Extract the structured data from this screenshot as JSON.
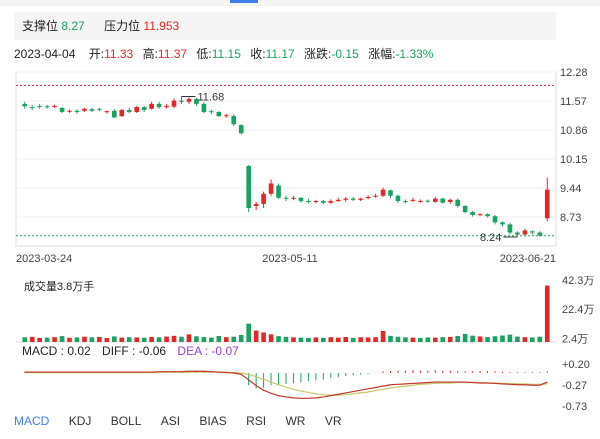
{
  "support": {
    "label": "支撑位",
    "value": "8.27"
  },
  "resistance": {
    "label": "压力位",
    "value": "11.953"
  },
  "info": {
    "date": "2023-04-04",
    "open_label": "开:",
    "open": "11.33",
    "high_label": "高:",
    "high": "11.37",
    "low_label": "低:",
    "low": "11.15",
    "close_label": "收:",
    "close": "11.17",
    "change_label": "涨跌:",
    "change": "-0.15",
    "pct_label": "涨幅:",
    "pct": "-1.33%"
  },
  "volume": {
    "title": "成交量3.8万手"
  },
  "macd": {
    "macd_label": "MACD : ",
    "macd": "0.02",
    "diff_label": "DIFF : ",
    "diff": "-0.06",
    "dea_label": "DEA : ",
    "dea": "-0.07"
  },
  "tabs": [
    "MACD",
    "KDJ",
    "BOLL",
    "ASI",
    "BIAS",
    "RSI",
    "WR",
    "VR"
  ],
  "colors": {
    "up": "#e02828",
    "down": "#1aa260",
    "accent": "#3f7de8",
    "resistance": "#e02828"
  },
  "chart_data": [
    {
      "type": "candlestick",
      "x_labels": [
        "2023-03-24",
        "2023-05-11",
        "2023-06-21"
      ],
      "y_ticks": [
        12.28,
        11.57,
        10.86,
        10.15,
        9.44,
        8.73
      ],
      "ylim": [
        8.02,
        12.28
      ],
      "resistance": 11.953,
      "support": 8.27,
      "annotations": [
        {
          "text": "11.68",
          "value": 11.68
        },
        {
          "text": "8.24",
          "value": 8.24
        }
      ],
      "candles": [
        [
          11.5,
          11.44,
          11.55,
          11.38
        ],
        [
          11.42,
          11.4,
          11.47,
          11.35
        ],
        [
          11.45,
          11.43,
          11.5,
          11.38
        ],
        [
          11.44,
          11.42,
          11.48,
          11.38
        ],
        [
          11.45,
          11.45,
          11.48,
          11.4
        ],
        [
          11.4,
          11.3,
          11.42,
          11.28
        ],
        [
          11.32,
          11.33,
          11.36,
          11.28
        ],
        [
          11.33,
          11.3,
          11.37,
          11.26
        ],
        [
          11.33,
          11.38,
          11.4,
          11.3
        ],
        [
          11.37,
          11.33,
          11.4,
          11.3
        ],
        [
          11.38,
          11.37,
          11.4,
          11.32
        ],
        [
          11.3,
          11.32,
          11.34,
          11.26
        ],
        [
          11.33,
          11.17,
          11.37,
          11.15
        ],
        [
          11.2,
          11.35,
          11.38,
          11.18
        ],
        [
          11.35,
          11.3,
          11.4,
          11.27
        ],
        [
          11.3,
          11.42,
          11.45,
          11.28
        ],
        [
          11.42,
          11.35,
          11.45,
          11.3
        ],
        [
          11.38,
          11.5,
          11.55,
          11.36
        ],
        [
          11.5,
          11.42,
          11.55,
          11.38
        ],
        [
          11.42,
          11.45,
          11.5,
          11.38
        ],
        [
          11.43,
          11.58,
          11.63,
          11.4
        ],
        [
          11.58,
          11.55,
          11.68,
          11.5
        ],
        [
          11.55,
          11.62,
          11.66,
          11.5
        ],
        [
          11.62,
          11.5,
          11.65,
          11.45
        ],
        [
          11.5,
          11.3,
          11.55,
          11.27
        ],
        [
          11.32,
          11.3,
          11.36,
          11.25
        ],
        [
          11.3,
          11.2,
          11.32,
          11.18
        ],
        [
          11.22,
          11.22,
          11.26,
          11.16
        ],
        [
          11.2,
          11.0,
          11.24,
          10.96
        ],
        [
          10.98,
          10.78,
          11.0,
          10.75
        ],
        [
          9.98,
          8.95,
          10.0,
          8.85
        ],
        [
          9.0,
          9.05,
          9.1,
          8.9
        ],
        [
          9.05,
          9.3,
          9.35,
          8.95
        ],
        [
          9.3,
          9.55,
          9.65,
          9.25
        ],
        [
          9.5,
          9.2,
          9.55,
          9.18
        ],
        [
          9.2,
          9.18,
          9.25,
          9.12
        ],
        [
          9.18,
          9.2,
          9.25,
          9.14
        ],
        [
          9.2,
          9.12,
          9.22,
          9.08
        ],
        [
          9.12,
          9.1,
          9.18,
          9.06
        ],
        [
          9.1,
          9.12,
          9.15,
          9.06
        ],
        [
          9.12,
          9.08,
          9.15,
          9.04
        ],
        [
          9.08,
          9.12,
          9.16,
          9.05
        ],
        [
          9.12,
          9.15,
          9.2,
          9.1
        ],
        [
          9.15,
          9.18,
          9.22,
          9.1
        ],
        [
          9.18,
          9.15,
          9.22,
          9.12
        ],
        [
          9.15,
          9.18,
          9.2,
          9.12
        ],
        [
          9.2,
          9.22,
          9.26,
          9.16
        ],
        [
          9.25,
          9.25,
          9.3,
          9.2
        ],
        [
          9.25,
          9.4,
          9.45,
          9.22
        ],
        [
          9.38,
          9.25,
          9.4,
          9.2
        ],
        [
          9.25,
          9.12,
          9.28,
          9.08
        ],
        [
          9.12,
          9.1,
          9.16,
          9.06
        ],
        [
          9.15,
          9.15,
          9.2,
          9.1
        ],
        [
          9.12,
          9.12,
          9.16,
          9.08
        ],
        [
          9.13,
          9.12,
          9.16,
          9.08
        ],
        [
          9.1,
          9.18,
          9.22,
          9.08
        ],
        [
          9.18,
          9.08,
          9.2,
          9.06
        ],
        [
          9.1,
          9.15,
          9.18,
          9.05
        ],
        [
          9.15,
          9.0,
          9.18,
          8.96
        ],
        [
          9.0,
          8.85,
          9.02,
          8.82
        ],
        [
          8.85,
          8.78,
          8.88,
          8.74
        ],
        [
          8.78,
          8.8,
          8.82,
          8.75
        ],
        [
          8.8,
          8.75,
          8.82,
          8.72
        ],
        [
          8.75,
          8.6,
          8.78,
          8.55
        ],
        [
          8.6,
          8.55,
          8.62,
          8.5
        ],
        [
          8.55,
          8.35,
          8.58,
          8.3
        ],
        [
          8.35,
          8.3,
          8.38,
          8.24
        ],
        [
          8.3,
          8.4,
          8.44,
          8.28
        ],
        [
          8.38,
          8.35,
          8.4,
          8.3
        ],
        [
          8.35,
          8.28,
          8.38,
          8.25
        ],
        [
          8.7,
          9.4,
          9.7,
          8.62
        ]
      ]
    },
    {
      "type": "bar",
      "name": "volume",
      "unit": "万手",
      "y_ticks": [
        "42.3万",
        "22.4万",
        "2.4万"
      ],
      "ylim": [
        0,
        42.3
      ],
      "values": [
        3.2,
        3.5,
        2.8,
        3.0,
        3.3,
        4.0,
        2.9,
        3.1,
        3.6,
        3.2,
        3.4,
        2.7,
        3.8,
        3.0,
        3.3,
        3.1,
        2.9,
        3.5,
        3.2,
        3.7,
        4.2,
        3.6,
        5.2,
        3.9,
        3.4,
        3.0,
        4.1,
        3.3,
        3.6,
        4.8,
        12.5,
        7.8,
        6.5,
        5.2,
        4.0,
        3.5,
        3.2,
        3.0,
        2.8,
        3.1,
        2.9,
        3.3,
        3.0,
        3.4,
        2.8,
        3.2,
        3.1,
        3.3,
        7.5,
        4.2,
        3.6,
        3.2,
        3.0,
        2.8,
        3.1,
        3.0,
        3.3,
        3.5,
        4.1,
        5.5,
        4.3,
        3.8,
        3.4,
        3.9,
        4.4,
        5.0,
        3.7,
        3.3,
        3.1,
        3.6,
        38.5
      ],
      "up": [
        0,
        1,
        1,
        0,
        1,
        0,
        1,
        0,
        1,
        0,
        1,
        1,
        0,
        1,
        0,
        1,
        0,
        1,
        0,
        1,
        1,
        0,
        1,
        0,
        0,
        0,
        0,
        1,
        0,
        0,
        0,
        1,
        1,
        1,
        0,
        0,
        1,
        0,
        0,
        1,
        0,
        1,
        1,
        1,
        0,
        1,
        1,
        1,
        1,
        0,
        0,
        0,
        1,
        0,
        0,
        1,
        0,
        1,
        0,
        0,
        0,
        1,
        0,
        0,
        0,
        0,
        0,
        1,
        0,
        0,
        1
      ]
    },
    {
      "type": "line",
      "name": "MACD",
      "y_ticks": [
        "+0.20",
        "-0.27",
        "-0.73"
      ],
      "ylim": [
        -0.73,
        0.2
      ],
      "hist": [
        0.03,
        0.03,
        0.03,
        0.02,
        0.02,
        0.02,
        0.02,
        0.02,
        0.02,
        0.03,
        0.03,
        0.03,
        0.02,
        0.03,
        0.03,
        0.03,
        0.03,
        0.03,
        0.03,
        0.03,
        0.04,
        0.04,
        0.05,
        0.04,
        0.03,
        0.02,
        0.01,
        0.0,
        -0.02,
        -0.04,
        -0.3,
        -0.38,
        -0.36,
        -0.3,
        -0.3,
        -0.27,
        -0.25,
        -0.23,
        -0.2,
        -0.18,
        -0.16,
        -0.12,
        -0.1,
        -0.07,
        -0.06,
        -0.04,
        -0.02,
        0.0,
        0.04,
        0.05,
        0.06,
        0.06,
        0.07,
        0.06,
        0.06,
        0.07,
        0.06,
        0.06,
        0.05,
        0.04,
        0.04,
        0.05,
        0.05,
        0.04,
        0.03,
        0.02,
        0.02,
        0.02,
        0.02,
        0.02,
        0.04
      ],
      "diff": [
        0.02,
        0.02,
        0.02,
        0.02,
        0.02,
        0.02,
        0.02,
        0.02,
        0.02,
        0.02,
        0.02,
        0.02,
        0.02,
        0.02,
        0.02,
        0.02,
        0.02,
        0.02,
        0.03,
        0.03,
        0.03,
        0.03,
        0.04,
        0.04,
        0.04,
        0.03,
        0.02,
        0.01,
        0.0,
        -0.03,
        -0.15,
        -0.28,
        -0.38,
        -0.45,
        -0.5,
        -0.53,
        -0.55,
        -0.56,
        -0.56,
        -0.55,
        -0.53,
        -0.5,
        -0.47,
        -0.44,
        -0.41,
        -0.38,
        -0.35,
        -0.32,
        -0.29,
        -0.26,
        -0.25,
        -0.24,
        -0.23,
        -0.22,
        -0.21,
        -0.2,
        -0.2,
        -0.2,
        -0.2,
        -0.2,
        -0.21,
        -0.22,
        -0.22,
        -0.23,
        -0.24,
        -0.25,
        -0.26,
        -0.26,
        -0.27,
        -0.27,
        -0.2
      ],
      "dea": [
        0.01,
        0.01,
        0.01,
        0.01,
        0.01,
        0.01,
        0.01,
        0.01,
        0.01,
        0.01,
        0.01,
        0.01,
        0.01,
        0.01,
        0.01,
        0.01,
        0.01,
        0.01,
        0.01,
        0.02,
        0.02,
        0.02,
        0.02,
        0.02,
        0.02,
        0.02,
        0.02,
        0.02,
        0.01,
        0.0,
        -0.03,
        -0.08,
        -0.14,
        -0.2,
        -0.26,
        -0.31,
        -0.36,
        -0.4,
        -0.43,
        -0.46,
        -0.48,
        -0.49,
        -0.49,
        -0.48,
        -0.46,
        -0.44,
        -0.42,
        -0.39,
        -0.36,
        -0.33,
        -0.31,
        -0.29,
        -0.27,
        -0.25,
        -0.24,
        -0.23,
        -0.22,
        -0.22,
        -0.21,
        -0.21,
        -0.21,
        -0.21,
        -0.22,
        -0.22,
        -0.23,
        -0.23,
        -0.24,
        -0.24,
        -0.25,
        -0.25,
        -0.24
      ]
    }
  ]
}
